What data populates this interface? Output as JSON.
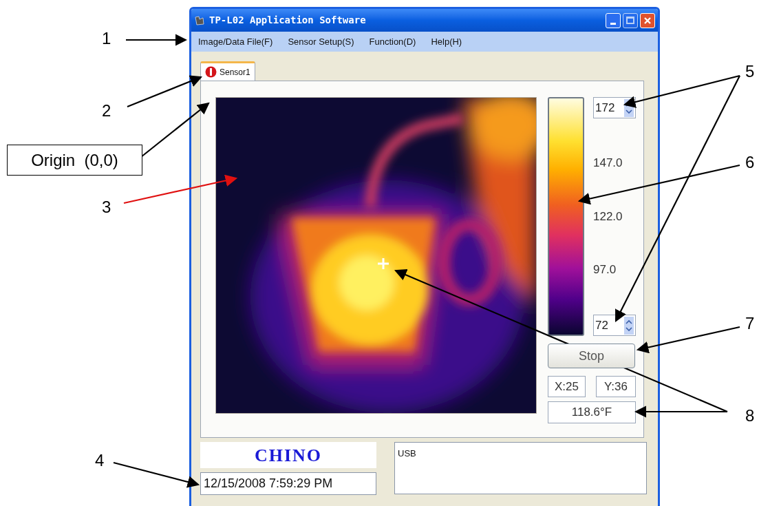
{
  "window": {
    "title": "TP-L02 Application Software"
  },
  "menu": [
    {
      "label": "Image/Data File(F)"
    },
    {
      "label": "Sensor Setup(S)"
    },
    {
      "label": "Function(D)"
    },
    {
      "label": "Help(H)"
    }
  ],
  "tabs": [
    {
      "label": "Sensor1",
      "selected": true
    }
  ],
  "scale": {
    "max": "172",
    "ticks": [
      "147.0",
      "122.0",
      "97.0"
    ],
    "min": "72"
  },
  "stop_button": "Stop",
  "cursor": {
    "x": "X:25",
    "y": "Y:36"
  },
  "temperature": "118.6°F",
  "logo": "CHINO",
  "datetime": "12/15/2008 7:59:29 PM",
  "status_box": "USB",
  "callouts": [
    {
      "label": "1"
    },
    {
      "label": "2"
    },
    {
      "label": "3"
    },
    {
      "label": "4"
    },
    {
      "label": "5"
    },
    {
      "label": "6"
    },
    {
      "label": "7"
    },
    {
      "label": "8"
    }
  ],
  "origin_label": "Origin  (0,0)"
}
